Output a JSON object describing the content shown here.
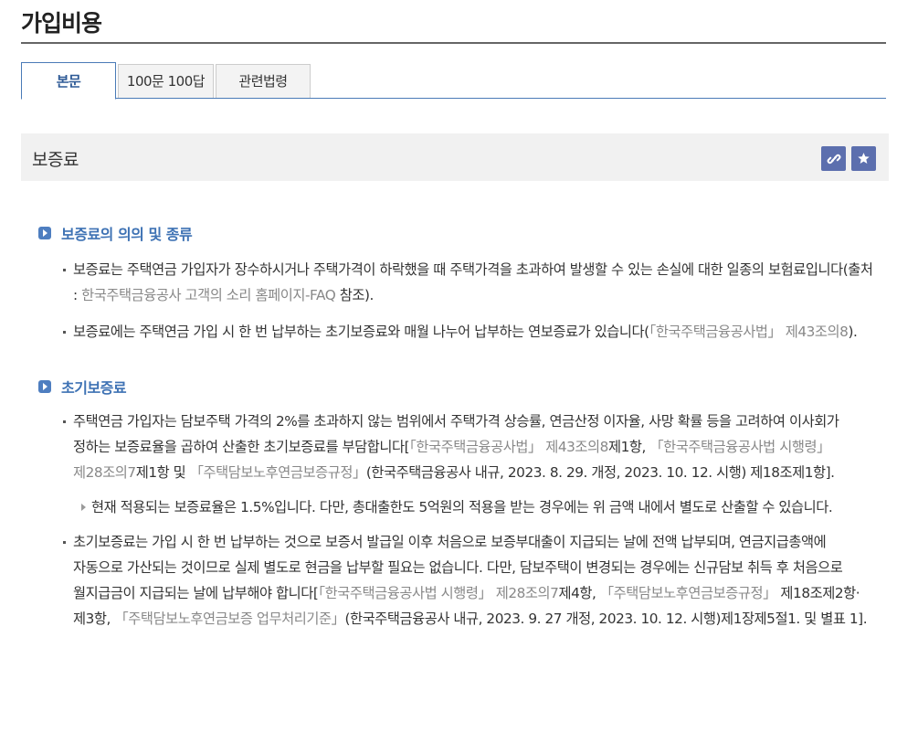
{
  "page": {
    "title": "가입비용"
  },
  "tabs": [
    {
      "label": "본문",
      "active": true
    },
    {
      "label": "100문 100답",
      "active": false
    },
    {
      "label": "관련법령",
      "active": false
    }
  ],
  "section": {
    "title": "보증료",
    "link_icon": "link-icon",
    "bookmark_icon": "star-icon",
    "accent_color": "#5c6fae"
  },
  "content": {
    "heading1": "보증료의 의의 및 종류",
    "p1": {
      "a": "보증료는 주택연금 가입자가 장수하시거나 주택가격이 하락했을 때 주택가격을 초과하여 발생할 수 있는 손실에 대한 일종의 보험료입니다(출처 : ",
      "ref": "한국주택금융공사 고객의 소리 홈페이지-FAQ",
      "b": " 참조)."
    },
    "p2": {
      "a": "보증료에는 주택연금 가입 시 한 번 납부하는 초기보증료와 매월 나누어 납부하는 연보증료가 있습니다(",
      "ref": "「한국주택금융공사법」 제43조의8",
      "b": ")."
    },
    "heading2": "초기보증료",
    "p3": {
      "a": "주택연금 가입자는 담보주택 가격의 2%를 초과하지 않는 범위에서 주택가격 상승률, 연금산정 이자율, 사망 확률 등을 고려하여 이사회가 정하는 보증료율을 곱하여 산출한 초기보증료를 부담합니다[",
      "ref1": "「한국주택금융공사법」 제43조의8",
      "b": "제1항, ",
      "ref2": "「한국주택금융공사법 시행령」 제28조의7",
      "c": "제1항 및 ",
      "ref3": "「주택담보노후연금보증규정」",
      "d": "(한국주택금융공사 내규, 2023. 8. 29. 개정, 2023. 10. 12. 시행) 제18조제1항]."
    },
    "sub1": "현재 적용되는 보증료율은 1.5%입니다. 다만, 총대출한도 5억원의 적용을 받는 경우에는 위 금액 내에서 별도로 산출할 수 있습니다.",
    "p4": {
      "a": "초기보증료는 가입 시 한 번 납부하는 것으로 보증서 발급일 이후 처음으로 보증부대출이 지급되는 날에 전액 납부되며, 연금지급총액에 자동으로 가산되는 것이므로 실제 별도로 현금을 납부할 필요는 없습니다. 다만, 담보주택이 변경되는 경우에는 신규담보 취득 후 처음으로 월지급금이 지급되는 날에 납부해야 합니다[",
      "ref1": "「한국주택금융공사법 시행령」 제28조의7",
      "b": "제4항, ",
      "ref2": "「주택담보노후연금보증규정」",
      "c": " 제18조제2항·제3항, ",
      "ref3": "「주택담보노후연금보증 업무처리기준」",
      "d": "(한국주택금융공사 내규, 2023. 9. 27 개정, 2023. 10. 12. 시행)제1장제5절1. 및 별표 1]."
    }
  }
}
